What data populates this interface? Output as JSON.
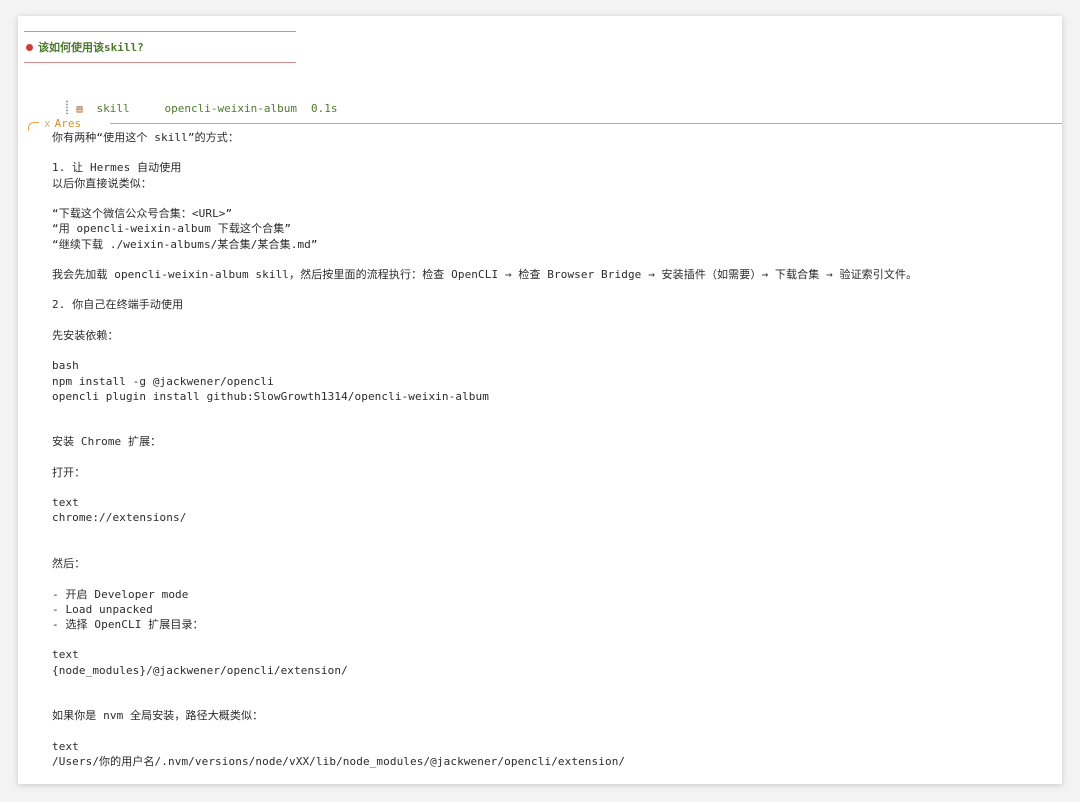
{
  "user_message": {
    "text": "该如何使用该skill?"
  },
  "tool_call": {
    "icon": "books-icon",
    "name": "skill",
    "target": "opencli-weixin-album",
    "duration": "0.1s"
  },
  "response": {
    "author_icon": "x",
    "author": "Ares",
    "lines": [
      "你有两种“使用这个 skill”的方式：",
      "",
      "1. 让 Hermes 自动使用",
      "以后你直接说类似：",
      "",
      "“下载这个微信公众号合集：<URL>”",
      "“用 opencli-weixin-album 下载这个合集”",
      "“继续下载 ./weixin-albums/某合集/某合集.md”",
      "",
      "我会先加载 opencli-weixin-album skill，然后按里面的流程执行：检查 OpenCLI → 检查 Browser Bridge → 安装插件（如需要）→ 下载合集 → 验证索引文件。",
      "",
      "2. 你自己在终端手动使用",
      "",
      "先安装依赖：",
      "",
      "bash",
      "npm install -g @jackwener/opencli",
      "opencli plugin install github:SlowGrowth1314/opencli-weixin-album",
      "",
      "",
      "安装 Chrome 扩展：",
      "",
      "打开：",
      "",
      "text",
      "chrome://extensions/",
      "",
      "",
      "然后：",
      "",
      "- 开启 Developer mode",
      "- Load unpacked",
      "- 选择 OpenCLI 扩展目录：",
      "",
      "text",
      "{node_modules}/@jackwener/opencli/extension/",
      "",
      "",
      "如果你是 nvm 全局安装，路径大概类似：",
      "",
      "text",
      "/Users/你的用户名/.nvm/versions/node/vXX/lib/node_modules/@jackwener/opencli/extension/"
    ]
  },
  "colors": {
    "user_accent": "#d23a3a",
    "user_text": "#4e7a2d",
    "response_accent": "#e0a64b",
    "body_text": "#2b2b2b"
  }
}
